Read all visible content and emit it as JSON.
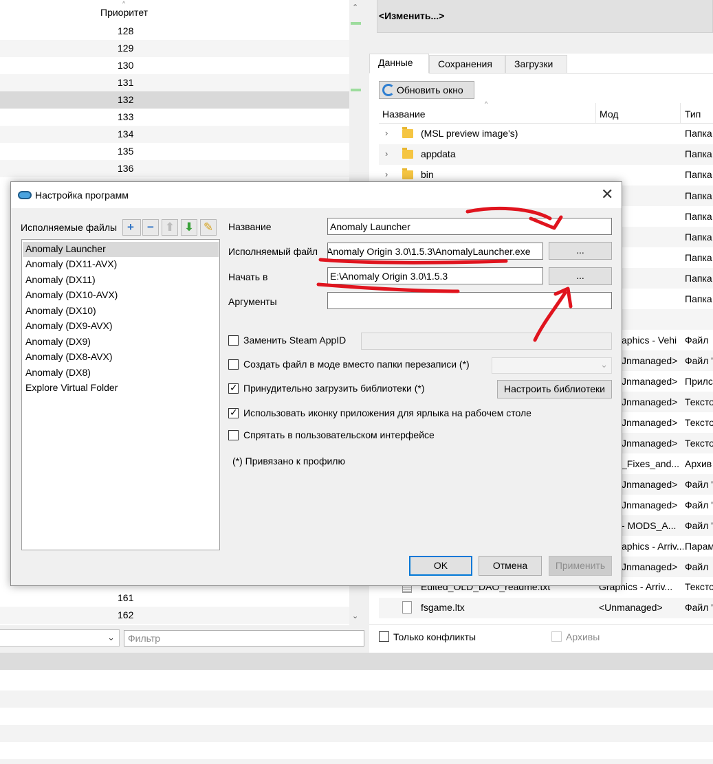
{
  "left_panel": {
    "priority_header": "Приоритет",
    "priority_rows": [
      "128",
      "129",
      "130",
      "131",
      "132",
      "133",
      "134",
      "135",
      "136"
    ],
    "bottom_rows": [
      "161",
      "162"
    ],
    "filter_placeholder": "Фильтр"
  },
  "right_panel": {
    "change_button": "<Изменить...>",
    "tabs": [
      "Данные",
      "Сохранения",
      "Загрузки"
    ],
    "refresh_button": "Обновить окно",
    "columns": {
      "name": "Название",
      "mod": "Мод",
      "type": "Тип"
    },
    "folders": [
      {
        "name": "(MSL preview image's)",
        "type": "Папка"
      },
      {
        "name": "appdata",
        "type": "Папка"
      },
      {
        "name": "bin",
        "type": "Папка"
      }
    ],
    "hidden_type_column": [
      "Папка",
      "Папка",
      "Папка",
      "Папка",
      "Папка",
      "Папка"
    ],
    "partial_rows": [
      {
        "mod": "aphics - Vehi",
        "type": "Файл"
      },
      {
        "mod": "Jnmanaged>",
        "type": "Файл '"
      },
      {
        "mod": "Jnmanaged>",
        "type": "Прилс"
      },
      {
        "mod": "Jnmanaged>",
        "type": "Тексто"
      },
      {
        "mod": "Jnmanaged>",
        "type": "Тексто"
      },
      {
        "mod": "Jnmanaged>",
        "type": "Тексто"
      },
      {
        "mod": "_Fixes_and...",
        "type": "Архив"
      },
      {
        "mod": "Jnmanaged>",
        "type": "Файл '"
      },
      {
        "mod": "Jnmanaged>",
        "type": "Файл '"
      },
      {
        "mod": "- MODS_A...",
        "type": "Файл '"
      },
      {
        "mod": "aphics - Arriv...",
        "type": "Парам"
      },
      {
        "mod": "Jnmanaged>",
        "type": "Файл"
      }
    ],
    "files": [
      {
        "name": "Edited_OLD_DAO_readme.txt",
        "mod": "Graphics - Arriv...",
        "type": "Тексто"
      },
      {
        "name": "fsgame.ltx",
        "mod": "<Unmanaged>",
        "type": "Файл '"
      }
    ],
    "only_conflicts": "Только конфликты",
    "archives": "Архивы"
  },
  "dialog": {
    "title": "Настройка программ",
    "executables_label": "Исполняемые файлы",
    "executables": [
      "Anomaly Launcher",
      "Anomaly (DX11-AVX)",
      "Anomaly (DX11)",
      "Anomaly (DX10-AVX)",
      "Anomaly (DX10)",
      "Anomaly (DX9-AVX)",
      "Anomaly (DX9)",
      "Anomaly (DX8-AVX)",
      "Anomaly (DX8)",
      "Explore Virtual Folder"
    ],
    "fields": {
      "name_label": "Название",
      "name_value": "Anomaly Launcher",
      "exe_label": "Исполняемый файл",
      "exe_value": "Anomaly Origin 3.0\\1.5.3\\AnomalyLauncher.exe",
      "start_label": "Начать в",
      "start_value": "E:\\Anomaly Origin 3.0\\1.5.3",
      "args_label": "Аргументы",
      "args_value": "",
      "browse": "..."
    },
    "options": {
      "steam_appid": "Заменить Steam AppID",
      "create_file": "Создать файл в моде вместо папки перезаписи (*)",
      "force_libs": "Принудительно загрузить библиотеки (*)",
      "use_icon": "Использовать иконку приложения для ярлыка на рабочем столе",
      "hide_ui": "Спрятать в пользовательском интерфейсе"
    },
    "configure_libs": "Настроить библиотеки",
    "profile_note": "(*) Привязано к профилю",
    "buttons": {
      "ok": "OK",
      "cancel": "Отмена",
      "apply": "Применить"
    }
  },
  "colors": {
    "annotation": "#e0141e",
    "selection": "#d9d9d9",
    "focus": "#0078d7"
  }
}
